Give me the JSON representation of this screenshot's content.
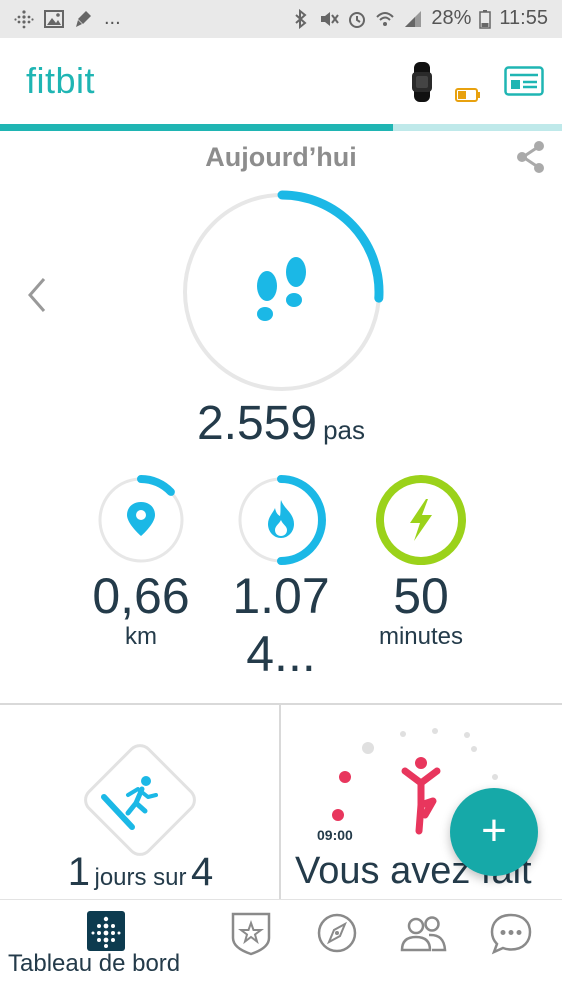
{
  "status_bar": {
    "battery_percent": "28%",
    "time": "11:55",
    "overflow": "..."
  },
  "header": {
    "logo": "fitbit",
    "sync_progress": 0.7,
    "colors": {
      "brand": "#1fb5b3",
      "accent_blue": "#1bb8e6",
      "active_green": "#9bd21a",
      "pink": "#e8365d"
    }
  },
  "dashboard": {
    "title": "Aujourd’hui",
    "steps": {
      "value": "2.559",
      "unit": "pas",
      "goal_fraction": 0.26
    },
    "stats": [
      {
        "id": "distance",
        "icon": "location-pin-icon",
        "value": "0,66",
        "unit": "km",
        "goal_fraction": 0.13
      },
      {
        "id": "calories",
        "icon": "flame-icon",
        "value": "1.07",
        "unit": "4...",
        "goal_fraction": 0.5
      },
      {
        "id": "active",
        "icon": "lightning-icon",
        "value": "50",
        "unit": "minutes",
        "goal_fraction": 1.0
      }
    ]
  },
  "tiles": {
    "exercise": {
      "count": "1",
      "text": "jours sur",
      "total": "4"
    },
    "hourly": {
      "time": "09:00",
      "text": "Vous avez fait"
    }
  },
  "fab": {
    "label": "+"
  },
  "bottom_nav": {
    "active_label": "Tableau de bord",
    "items": [
      {
        "icon": "dashboard-grid-icon"
      },
      {
        "icon": "challenges-star-icon"
      },
      {
        "icon": "discover-compass-icon"
      },
      {
        "icon": "friends-icon"
      },
      {
        "icon": "chat-icon"
      }
    ]
  }
}
